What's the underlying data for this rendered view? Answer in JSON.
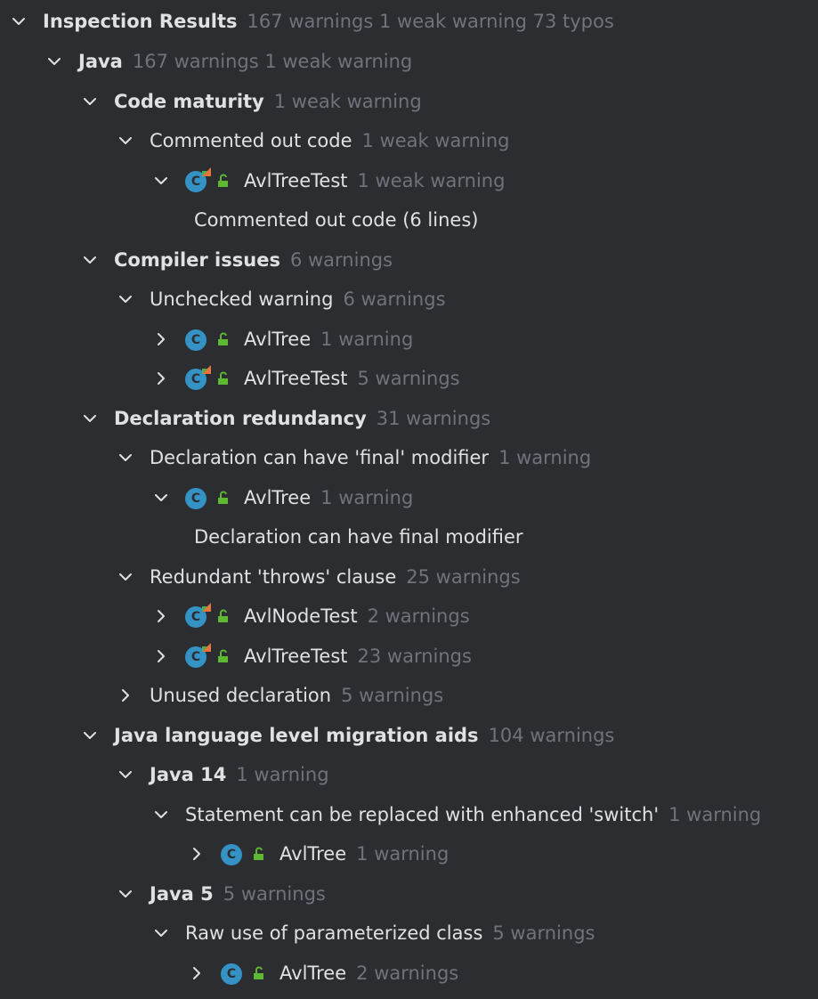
{
  "tree": [
    {
      "depth": 0,
      "expanded": true,
      "label": "Inspection Results",
      "bold": true,
      "count": "167 warnings 1 weak warning 73 typos"
    },
    {
      "depth": 1,
      "expanded": true,
      "label": "Java",
      "bold": true,
      "count": "167 warnings 1 weak warning"
    },
    {
      "depth": 2,
      "expanded": true,
      "label": "Code maturity",
      "bold": true,
      "count": "1 weak warning"
    },
    {
      "depth": 3,
      "expanded": true,
      "label": "Commented out code",
      "bold": false,
      "count": "1 weak warning"
    },
    {
      "depth": 4,
      "expanded": true,
      "label": "AvlTreeTest",
      "bold": false,
      "count": "1 weak warning",
      "icon": "test-class-icon"
    },
    {
      "depth": 5,
      "leaf": true,
      "label": "Commented out code (6 lines)"
    },
    {
      "depth": 2,
      "expanded": true,
      "label": "Compiler issues",
      "bold": true,
      "count": "6 warnings"
    },
    {
      "depth": 3,
      "expanded": true,
      "label": "Unchecked warning",
      "bold": false,
      "count": "6 warnings"
    },
    {
      "depth": 4,
      "expanded": false,
      "label": "AvlTree",
      "bold": false,
      "count": "1 warning",
      "icon": "class-icon"
    },
    {
      "depth": 4,
      "expanded": false,
      "label": "AvlTreeTest",
      "bold": false,
      "count": "5 warnings",
      "icon": "test-class-icon"
    },
    {
      "depth": 2,
      "expanded": true,
      "label": "Declaration redundancy",
      "bold": true,
      "count": "31 warnings"
    },
    {
      "depth": 3,
      "expanded": true,
      "label": "Declaration can have 'final' modifier",
      "bold": false,
      "count": "1 warning"
    },
    {
      "depth": 4,
      "expanded": true,
      "label": "AvlTree",
      "bold": false,
      "count": "1 warning",
      "icon": "class-icon"
    },
    {
      "depth": 5,
      "leaf": true,
      "label": "Declaration can have final modifier"
    },
    {
      "depth": 3,
      "expanded": true,
      "label": "Redundant 'throws' clause",
      "bold": false,
      "count": "25 warnings"
    },
    {
      "depth": 4,
      "expanded": false,
      "label": "AvlNodeTest",
      "bold": false,
      "count": "2 warnings",
      "icon": "test-class-icon"
    },
    {
      "depth": 4,
      "expanded": false,
      "label": "AvlTreeTest",
      "bold": false,
      "count": "23 warnings",
      "icon": "test-class-icon"
    },
    {
      "depth": 3,
      "expanded": false,
      "label": "Unused declaration",
      "bold": false,
      "count": "5 warnings"
    },
    {
      "depth": 2,
      "expanded": true,
      "label": "Java language level migration aids",
      "bold": true,
      "count": "104 warnings"
    },
    {
      "depth": 3,
      "expanded": true,
      "label": "Java 14",
      "bold": true,
      "count": "1 warning"
    },
    {
      "depth": 4,
      "expanded": true,
      "label": "Statement can be replaced with enhanced 'switch'",
      "bold": false,
      "count": "1 warning"
    },
    {
      "depth": 5,
      "expanded": false,
      "label": "AvlTree",
      "bold": false,
      "count": "1 warning",
      "icon": "class-icon"
    },
    {
      "depth": 3,
      "expanded": true,
      "label": "Java 5",
      "bold": true,
      "count": "5 warnings"
    },
    {
      "depth": 4,
      "expanded": true,
      "label": "Raw use of parameterized class",
      "bold": false,
      "count": "5 warnings"
    },
    {
      "depth": 5,
      "expanded": false,
      "label": "AvlTree",
      "bold": false,
      "count": "2 warnings",
      "icon": "class-icon"
    },
    {
      "depth": 5,
      "expanded": false,
      "label": "",
      "bold": false,
      "count": "",
      "icon": "test-class-icon",
      "partial": true
    }
  ],
  "colors": {
    "background": "#2b2d30",
    "text": "#dfe1e5",
    "muted": "#6f737a",
    "class_icon": "#3592c4",
    "lock_icon": "#5fb832",
    "test_mark": "#e8743b"
  },
  "icon_letter": "C"
}
